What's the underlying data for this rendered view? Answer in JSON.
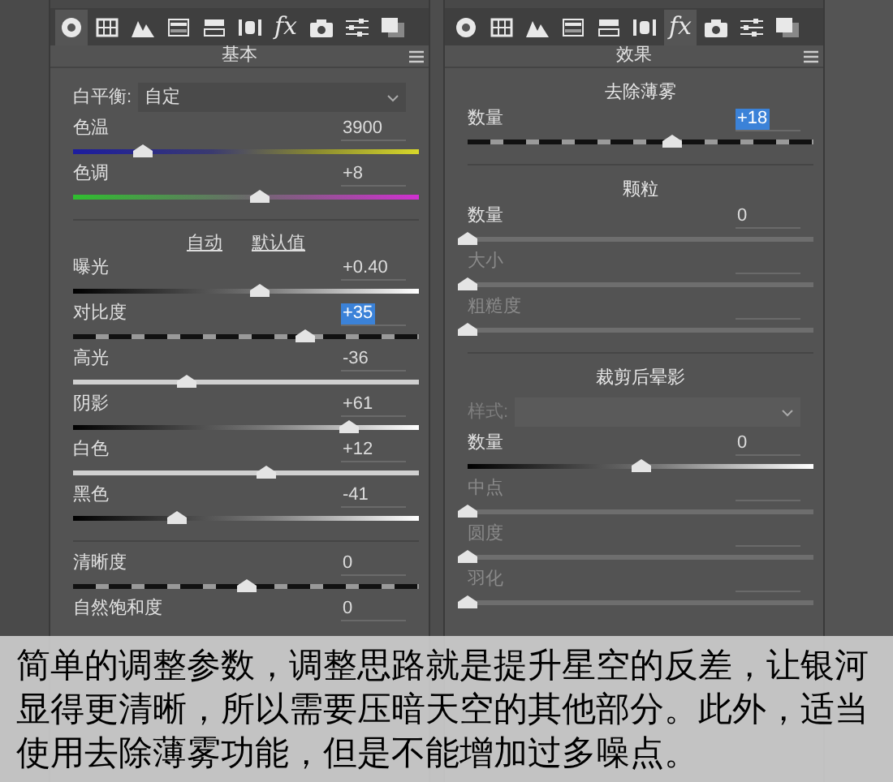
{
  "panels": [
    {
      "tabs": [
        {
          "selected": true
        },
        {
          "selected": false
        },
        {
          "selected": false
        },
        {
          "selected": false
        },
        {
          "selected": false
        },
        {
          "selected": false
        },
        {
          "label": "fx",
          "selected": false
        },
        {
          "selected": false
        },
        {
          "selected": false
        },
        {
          "selected": false
        }
      ],
      "title": "基本",
      "sections": [
        {
          "select": {
            "label": "白平衡:",
            "value": "自定",
            "disabled": false
          },
          "rows": [
            {
              "label": "色温",
              "value": "3900",
              "kind": "temp",
              "level": 0.2,
              "disabled": false,
              "highlighted": false
            },
            {
              "label": "色调",
              "value": "+8",
              "kind": "tint",
              "level": 0.54,
              "disabled": false,
              "highlighted": false
            }
          ]
        },
        {
          "links": [
            "自动",
            "默认值"
          ],
          "rows": [
            {
              "label": "曝光",
              "value": "+0.40",
              "kind": "bw",
              "level": 0.54,
              "disabled": false,
              "highlighted": false
            },
            {
              "label": "对比度",
              "value": "+35",
              "kind": "dashed",
              "level": 0.67,
              "disabled": false,
              "highlighted": true
            },
            {
              "label": "高光",
              "value": "-36",
              "kind": "plain",
              "level": 0.33,
              "disabled": false,
              "highlighted": false
            },
            {
              "label": "阴影",
              "value": "+61",
              "kind": "bw",
              "level": 0.8,
              "disabled": false,
              "highlighted": false
            },
            {
              "label": "白色",
              "value": "+12",
              "kind": "plain",
              "level": 0.56,
              "disabled": false,
              "highlighted": false
            },
            {
              "label": "黑色",
              "value": "-41",
              "kind": "bw",
              "level": 0.3,
              "disabled": false,
              "highlighted": false
            }
          ]
        },
        {
          "rows": [
            {
              "label": "清晰度",
              "value": "0",
              "kind": "dashed",
              "level": 0.5,
              "disabled": false,
              "highlighted": false
            },
            {
              "label": "自然饱和度",
              "value": "0",
              "disabled": false,
              "highlighted": false
            }
          ]
        }
      ]
    },
    {
      "tabs": [
        {
          "selected": false
        },
        {
          "selected": false
        },
        {
          "selected": false
        },
        {
          "selected": false
        },
        {
          "selected": false
        },
        {
          "selected": false
        },
        {
          "label": "fx",
          "selected": true
        },
        {
          "selected": false
        },
        {
          "selected": false
        },
        {
          "selected": false
        }
      ],
      "title": "效果",
      "sections": [
        {
          "heading": "去除薄雾",
          "rows": [
            {
              "label": "数量",
              "value": "+18",
              "kind": "dashed",
              "level": 0.59,
              "disabled": false,
              "highlighted": true
            }
          ]
        },
        {
          "heading": "颗粒",
          "rows": [
            {
              "label": "数量",
              "value": "0",
              "kind": "dim",
              "level": 0,
              "disabled": false,
              "highlighted": false
            },
            {
              "label": "大小",
              "kind": "dim",
              "level": 0,
              "disabled": true
            },
            {
              "label": "粗糙度",
              "kind": "dim",
              "level": 0,
              "disabled": true
            }
          ]
        },
        {
          "heading": "裁剪后晕影",
          "select": {
            "label": "样式:",
            "disabled": true
          },
          "rows": [
            {
              "label": "数量",
              "value": "0",
              "kind": "bw",
              "level": 0.5,
              "disabled": false,
              "highlighted": false
            },
            {
              "label": "中点",
              "kind": "dim",
              "level": 0,
              "disabled": true
            },
            {
              "label": "圆度",
              "kind": "dim",
              "level": 0,
              "disabled": true
            },
            {
              "label": "羽化",
              "kind": "dim",
              "level": 0,
              "disabled": true
            }
          ]
        }
      ]
    }
  ],
  "caption": [
    "简单的调整参数，调整思路就是提升星空的反差，让银河",
    "显得更清晰，所以需要压暗天空的其他部分。此外，适当",
    "使用去除薄雾功能，但是不能增加过多噪点。"
  ]
}
